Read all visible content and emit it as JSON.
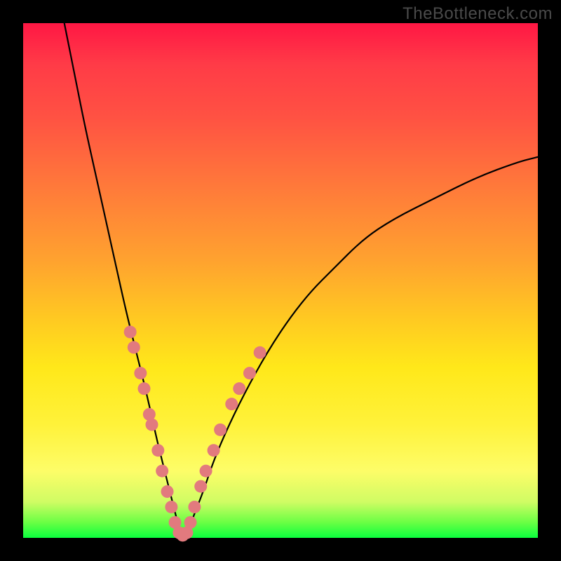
{
  "watermark": "TheBottleneck.com",
  "chart_data": {
    "type": "line",
    "title": "",
    "xlabel": "",
    "ylabel": "",
    "xlim": [
      0,
      100
    ],
    "ylim": [
      0,
      100
    ],
    "grid": false,
    "legend": false,
    "annotations": [],
    "series": [
      {
        "name": "main-curve",
        "x": [
          8,
          10,
          12,
          14,
          16,
          18,
          20,
          22,
          24,
          26,
          27,
          28,
          29,
          30,
          31,
          32,
          33,
          35,
          37,
          40,
          44,
          48,
          52,
          56,
          60,
          66,
          72,
          80,
          88,
          96,
          100
        ],
        "y": [
          100,
          90,
          80,
          71,
          62,
          53,
          44,
          36,
          28,
          19,
          15,
          11,
          7,
          3,
          0,
          1,
          4,
          9,
          15,
          22,
          30,
          37,
          43,
          48,
          52,
          58,
          62,
          66,
          70,
          73,
          74
        ]
      }
    ],
    "markers": [
      {
        "x": 20.8,
        "y": 40
      },
      {
        "x": 21.5,
        "y": 37
      },
      {
        "x": 22.8,
        "y": 32
      },
      {
        "x": 23.5,
        "y": 29
      },
      {
        "x": 24.5,
        "y": 24
      },
      {
        "x": 25.0,
        "y": 22
      },
      {
        "x": 26.2,
        "y": 17
      },
      {
        "x": 27.0,
        "y": 13
      },
      {
        "x": 28.0,
        "y": 9
      },
      {
        "x": 28.8,
        "y": 6
      },
      {
        "x": 29.5,
        "y": 3
      },
      {
        "x": 30.3,
        "y": 1
      },
      {
        "x": 31.0,
        "y": 0.5
      },
      {
        "x": 31.8,
        "y": 1
      },
      {
        "x": 32.5,
        "y": 3
      },
      {
        "x": 33.3,
        "y": 6
      },
      {
        "x": 34.5,
        "y": 10
      },
      {
        "x": 35.5,
        "y": 13
      },
      {
        "x": 37.0,
        "y": 17
      },
      {
        "x": 38.3,
        "y": 21
      },
      {
        "x": 40.5,
        "y": 26
      },
      {
        "x": 42.0,
        "y": 29
      },
      {
        "x": 44.0,
        "y": 32
      },
      {
        "x": 46.0,
        "y": 36
      }
    ],
    "marker_style": {
      "fill": "#e27a7e",
      "radius": 9
    }
  }
}
